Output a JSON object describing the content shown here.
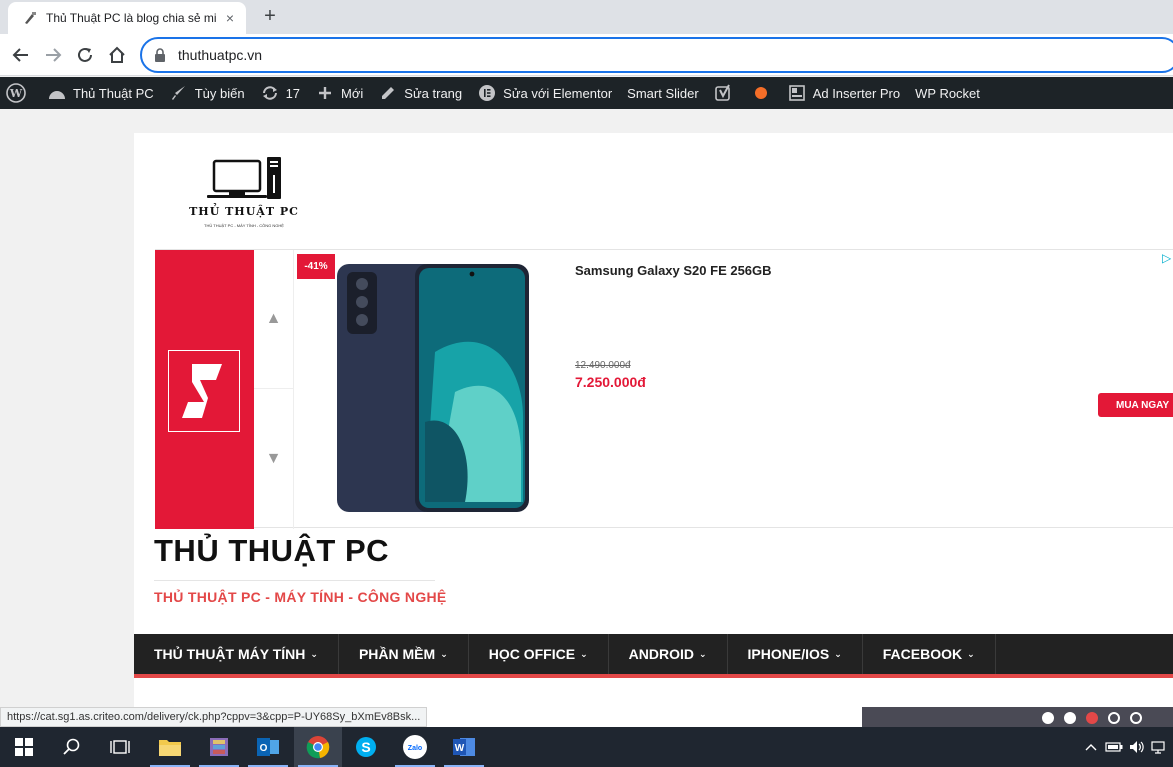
{
  "browser": {
    "tab_title": "Thủ Thuật PC là blog chia sẻ miễ",
    "tab_close": "×",
    "new_tab": "+",
    "url": "thuthuatpc.vn",
    "url_overflow": "L"
  },
  "adminbar": {
    "items": [
      {
        "label": "Thủ Thuật PC",
        "icon": "dashboard-icon"
      },
      {
        "label": "Tùy biến",
        "icon": "brush-icon"
      },
      {
        "label": "17",
        "icon": "refresh-icon"
      },
      {
        "label": "Mới",
        "icon": "plus-icon"
      },
      {
        "label": "Sửa trang",
        "icon": "pencil-icon"
      },
      {
        "label": "Sửa với Elementor",
        "icon": "elementor-icon"
      },
      {
        "label": "Smart Slider",
        "icon": ""
      },
      {
        "label": "Ad Inserter Pro",
        "icon": "grid-icon"
      },
      {
        "label": "WP Rocket",
        "icon": ""
      }
    ],
    "colors": {
      "bg": "#1d2327",
      "seo_dot": "#f56e28"
    }
  },
  "logo": {
    "text": "THỦ THUẬT PC",
    "subtext": "THỦ THUẬT PC - MÁY TÍNH - CÔNG NGHỆ"
  },
  "ad": {
    "discount": "-41%",
    "product_name": "Samsung Galaxy S20 FE 256GB",
    "old_price": "12.490.000đ",
    "new_price": "7.250.000đ",
    "buy_label": "MUA NGAY",
    "up_arrow": "▲",
    "down_arrow": "▼",
    "adchoice": "▷",
    "colors": {
      "brand_red": "#e31837"
    }
  },
  "site": {
    "title": "THỦ THUẬT PC",
    "tagline": "THỦ THUẬT PC - MÁY TÍNH - CÔNG NGHỆ"
  },
  "menu": {
    "items": [
      "THỦ THUẬT MÁY TÍNH",
      "PHẦN MỀM",
      "HỌC OFFICE",
      "ANDROID",
      "IPHONE/IOS",
      "FACEBOOK"
    ],
    "chevron": "⌄",
    "colors": {
      "bg": "#222222",
      "accent": "#e34848"
    }
  },
  "status_url": "https://cat.sg1.as.criteo.com/delivery/ck.php?cppv=3&cpp=P-UY68Sy_bXmEv8Bsk...",
  "taskbar": {
    "apps": [
      "windows-start-icon",
      "search-icon",
      "task-view-icon",
      "file-explorer-icon",
      "archive-icon",
      "outlook-icon",
      "chrome-icon",
      "skype-icon",
      "zalo-icon",
      "word-icon"
    ],
    "zalo_label": "Zalo"
  }
}
